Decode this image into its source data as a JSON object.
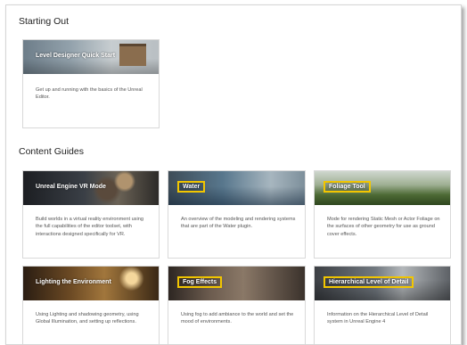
{
  "sections": {
    "starting_out": "Starting Out",
    "content_guides": "Content Guides"
  },
  "cards": {
    "quick_start": {
      "title": "Level Designer Quick Start",
      "desc": "Get up and running with the basics of the Unreal Editor."
    },
    "vr_mode": {
      "title": "Unreal Engine VR Mode",
      "desc": "Build worlds in a virtual reality environment using the full capabilities of the editor toolset, with interactions designed specifically for VR."
    },
    "water": {
      "title": "Water",
      "desc": "An overview of the modeling and rendering systems that are part of the Water plugin."
    },
    "foliage": {
      "title": "Foliage Tool",
      "desc": "Mode for rendering Static Mesh or Actor Foliage on the surfaces of other geometry for use as ground cover effects."
    },
    "lighting": {
      "title": "Lighting the Environment",
      "desc": "Using Lighting and shadowing geometry, using Global Illumination, and setting up reflections."
    },
    "fog": {
      "title": "Fog Effects",
      "desc": "Using fog to add ambiance to the world and set the mood of environments."
    },
    "hlod": {
      "title": "Hierarchical Level of Detail",
      "desc": "Information on the Hierarchical Level of Detail system in Unreal Engine 4"
    }
  },
  "colors": {
    "highlight": "#f2c600",
    "card_border": "#d9d9d9",
    "text_dark": "#222222",
    "text_muted": "#555555"
  }
}
